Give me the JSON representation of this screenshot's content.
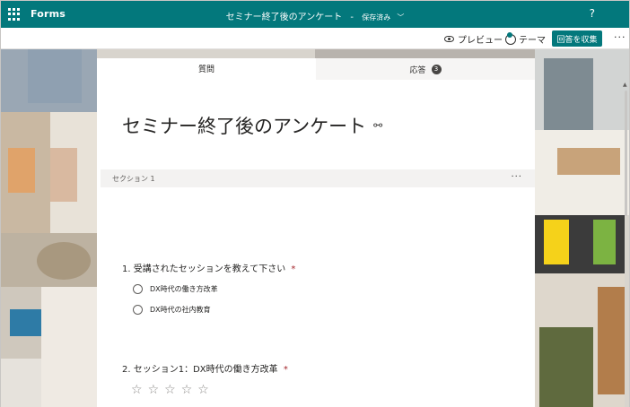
{
  "app": {
    "name": "Forms",
    "help": "?"
  },
  "document": {
    "title": "セミナー終了後のアンケート",
    "separator": "-",
    "saved_status": "保存済み"
  },
  "command_bar": {
    "preview_label": "プレビュー",
    "theme_label": "テーマ",
    "collect_label": "回答を収集",
    "more": "···"
  },
  "tabs": [
    {
      "label": "質問",
      "active": true
    },
    {
      "label": "応答",
      "count": "3",
      "active": false
    }
  ],
  "form": {
    "title": "セミナー終了後のアンケート",
    "section_label": "セクション 1",
    "section_more": "···",
    "questions": [
      {
        "number": "1.",
        "text": "受講されたセッションを教えて下さい",
        "required": "*",
        "options": [
          "DX時代の働き方改革",
          "DX時代の社内教育"
        ]
      },
      {
        "number": "2.",
        "text": "セッション1：DX時代の働き方改革",
        "required": "*",
        "rating_max": 5
      }
    ]
  },
  "colors": {
    "brand": "#03787c",
    "required": "#a4262c"
  }
}
